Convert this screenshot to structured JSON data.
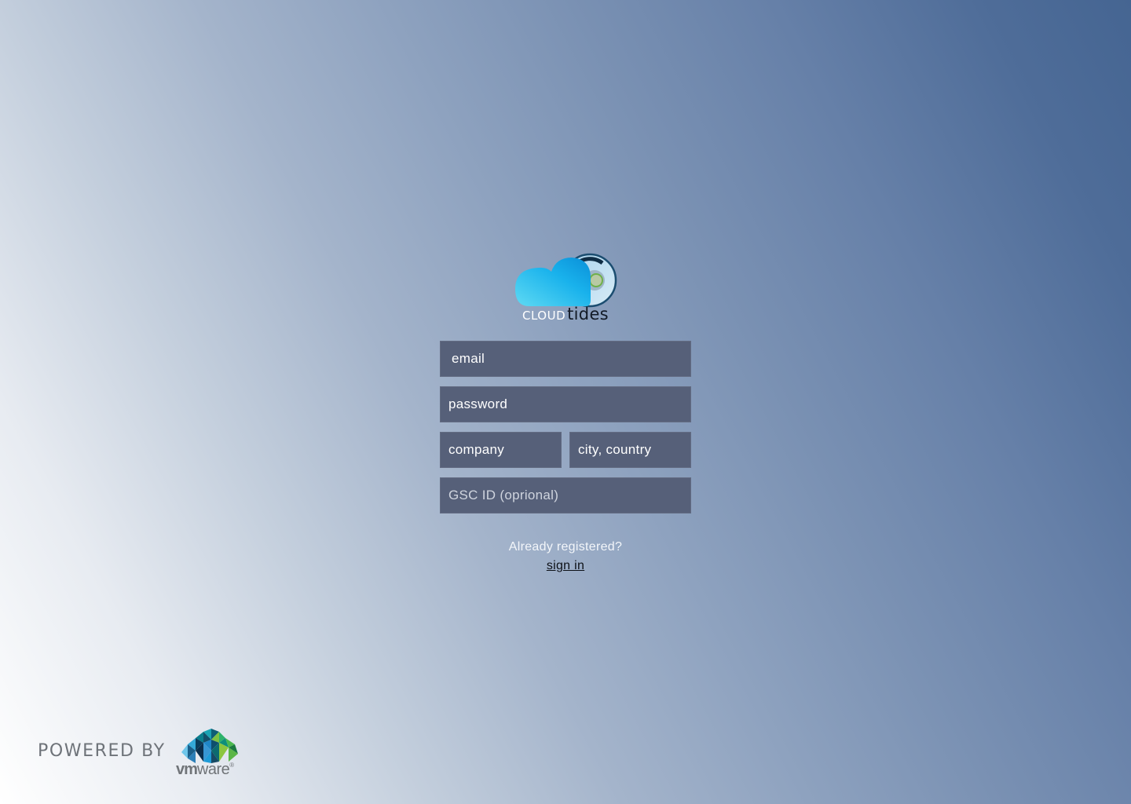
{
  "brand": {
    "logo_word_cloud": "CLOUD",
    "logo_word_tides": "tides",
    "colors": {
      "cloud_gradient_start": "#5bd7f2",
      "cloud_gradient_end": "#0c9fdf",
      "ring": "#1c4f72",
      "ring_dot": "#8ac44a"
    }
  },
  "form": {
    "email": {
      "placeholder": "email",
      "value": ""
    },
    "password": {
      "placeholder": "password",
      "value": ""
    },
    "company": {
      "placeholder": "company",
      "value": ""
    },
    "city_country": {
      "placeholder": "city, country",
      "value": ""
    },
    "gsc_id": {
      "placeholder": "GSC ID (oprional)",
      "value": ""
    },
    "field_background": "#566079"
  },
  "signin": {
    "prompt": "Already registered?",
    "link_label": "sign in"
  },
  "footer": {
    "powered_by": "POWERED BY",
    "vmware_logo": "vmware-logo"
  },
  "theme": {
    "background_gradient": [
      "#ffffff",
      "#a4b4cb",
      "#456592"
    ]
  }
}
